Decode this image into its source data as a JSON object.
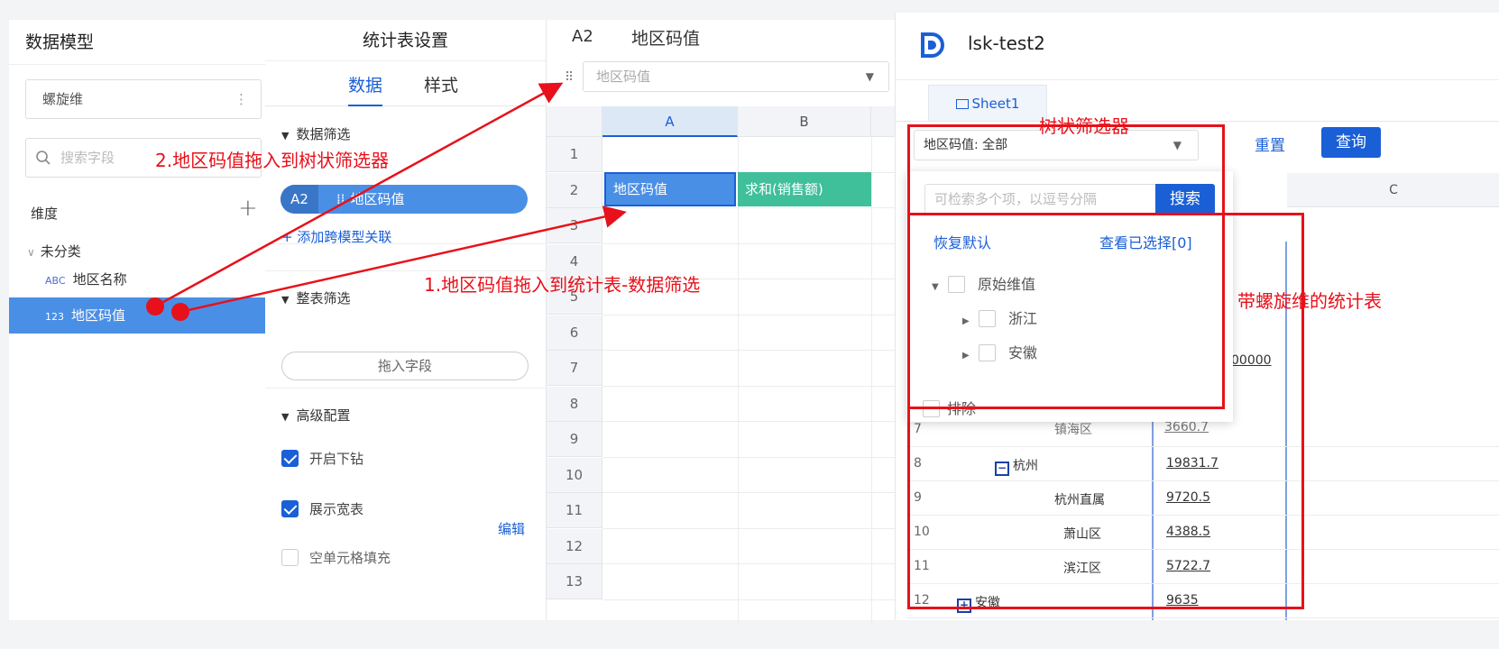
{
  "left_panel": {
    "title": "数据模型",
    "model": "螺旋维",
    "more_glyph": "⋮",
    "search_placeholder": "搜索字段",
    "dimension_label": "维度",
    "add_glyph": "+",
    "category": "未分类",
    "category_chevron": "∨",
    "fields": [
      {
        "type_badge": "ABC",
        "label": "地区名称"
      },
      {
        "type_badge": "123",
        "label": "地区码值"
      }
    ]
  },
  "middle_panel": {
    "title": "统计表设置",
    "tabs": [
      "数据",
      "样式"
    ],
    "data_filter_title": "数据筛选",
    "pill_ref": "A2",
    "pill_icon": "⁞⁞",
    "pill_label": "地区码值",
    "add_relation": "+ 添加跨模型关联",
    "table_filter_title": "整表筛选",
    "drop_field": "拖入字段",
    "advanced_title": "高级配置",
    "options": [
      {
        "label": "开启下钻",
        "checked": true
      },
      {
        "label": "展示宽表",
        "checked": true
      },
      {
        "label": "空单元格填充",
        "checked": false
      }
    ],
    "edit_label": "编辑"
  },
  "sheet": {
    "cell_ref": "A2",
    "cell_value": "地区码值",
    "grip_glyph": "⠿",
    "dropdown_value": "地区码值",
    "dropdown_arrow": "▼",
    "columns": [
      "A",
      "B"
    ],
    "rows": [
      "1",
      "2",
      "3",
      "4",
      "5",
      "6",
      "7",
      "8",
      "9",
      "10",
      "11",
      "12",
      "13"
    ],
    "a2": "地区码值",
    "b2": "求和(销售额)"
  },
  "preview": {
    "title": "lsk-test2",
    "sheet_tab": "Sheet1",
    "filter_value": "地区码值: 全部",
    "filter_arrow": "▼",
    "reset": "重置",
    "query": "查询",
    "col_c": "C",
    "partial_value": "00000",
    "partial_row7_name": "镇海区",
    "partial_row7_value": "3660.7",
    "rows": [
      {
        "num": "7",
        "name": "",
        "value": ""
      },
      {
        "num": "8",
        "name": "杭州",
        "value": "19831.7",
        "toggle": "−"
      },
      {
        "num": "9",
        "name": "杭州直属",
        "value": "9720.5"
      },
      {
        "num": "10",
        "name": "萧山区",
        "value": "4388.5"
      },
      {
        "num": "11",
        "name": "滨江区",
        "value": "5722.7"
      },
      {
        "num": "12",
        "name": "安徽",
        "value": "9635",
        "toggle": "+"
      }
    ],
    "tree_dropdown": {
      "search_placeholder": "可检索多个项，以逗号分隔",
      "search_button": "搜索",
      "restore_default": "恢复默认",
      "view_selected": "查看已选择[0]",
      "nodes": [
        "原始维值",
        "浙江",
        "安徽"
      ],
      "exclude": "排除",
      "expanded_glyph": "▼",
      "collapsed_glyph": "▶"
    }
  },
  "annotations": {
    "step2": "2.地区码值拖入到树状筛选器",
    "step1": "1.地区码值拖入到统计表-数据筛选",
    "tree_filter": "树状筛选器",
    "spiral_table": "带螺旋维的统计表",
    "color": "#e8101a"
  },
  "colors": {
    "accent": "#1a5fd6",
    "selected_field": "#4a8fe6",
    "measure_cell": "#3fbf9a"
  }
}
